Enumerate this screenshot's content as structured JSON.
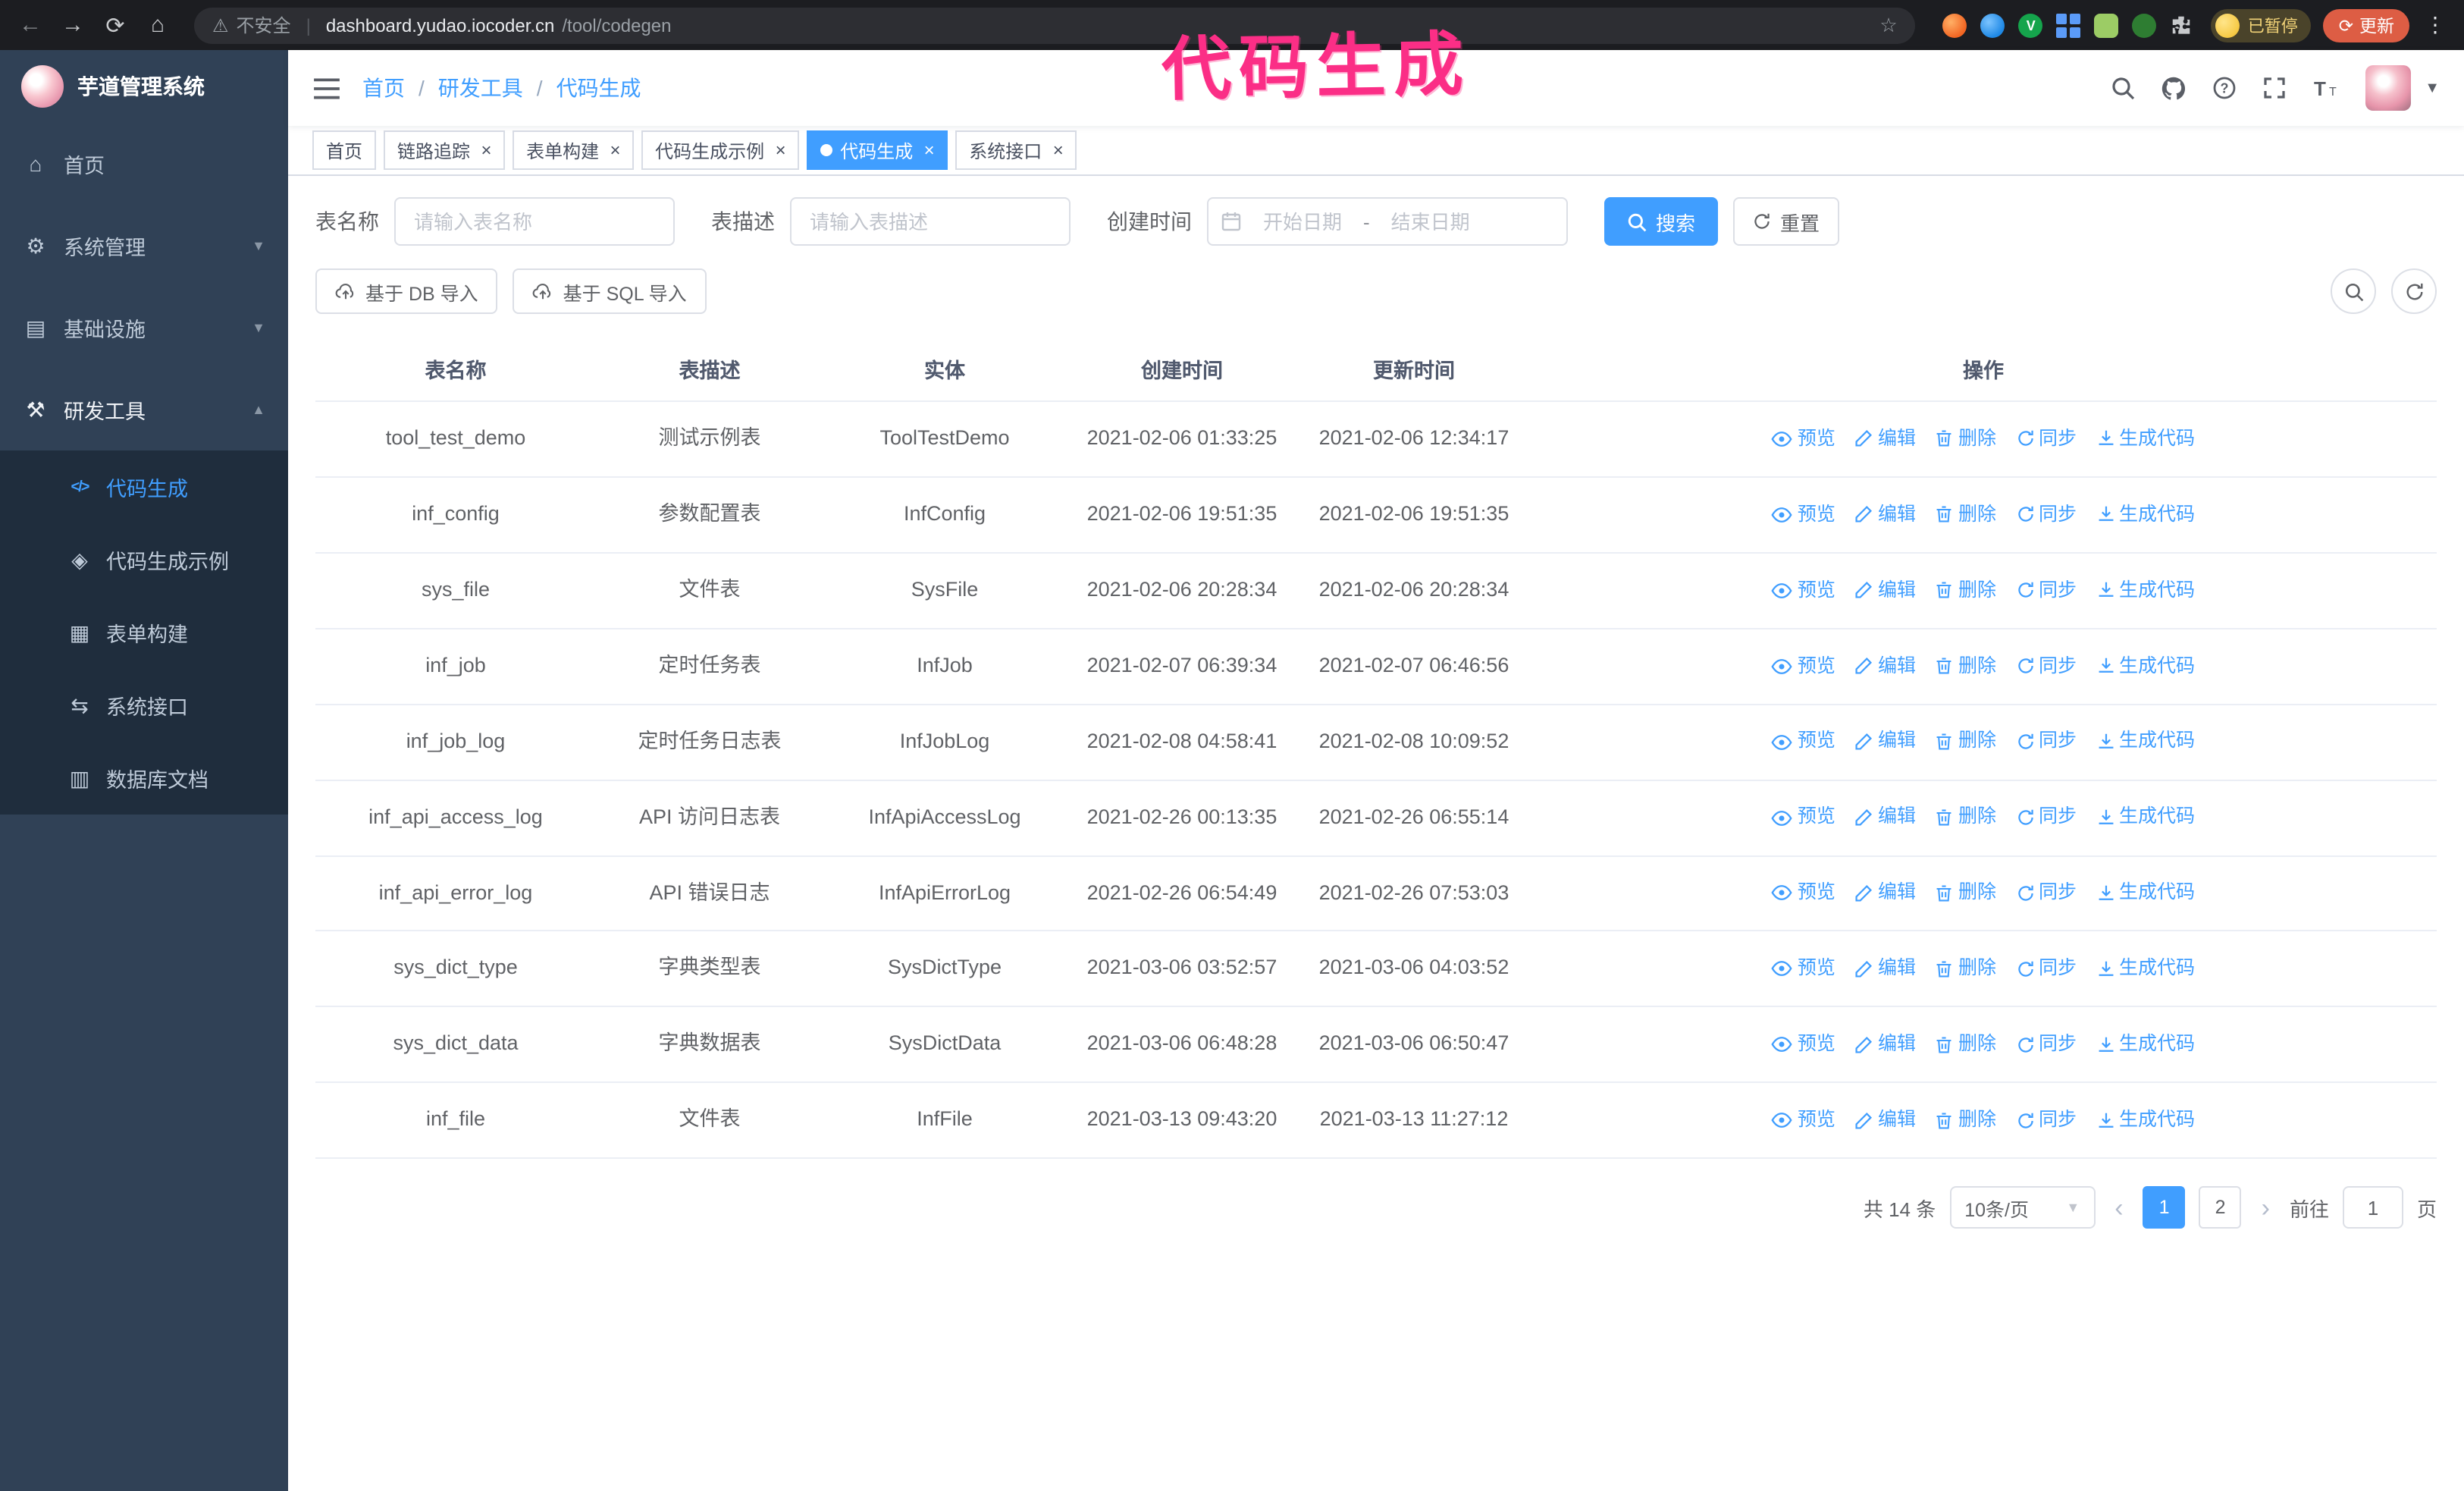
{
  "browser": {
    "security_label": "不安全",
    "url_host": "dashboard.yudao.iocoder.cn",
    "url_path": "/tool/codegen",
    "paused_badge": "已暂停",
    "update_label": "更新"
  },
  "annotation": "代码生成",
  "sidebar": {
    "logo_title": "芋道管理系统",
    "items": [
      {
        "label": "首页"
      },
      {
        "label": "系统管理"
      },
      {
        "label": "基础设施"
      },
      {
        "label": "研发工具"
      }
    ],
    "subitems": [
      {
        "label": "代码生成",
        "active": true
      },
      {
        "label": "代码生成示例"
      },
      {
        "label": "表单构建"
      },
      {
        "label": "系统接口"
      },
      {
        "label": "数据库文档"
      }
    ]
  },
  "header": {
    "breadcrumb": [
      "首页",
      "研发工具",
      "代码生成"
    ],
    "breadcrumb_separator": "/"
  },
  "tabs": [
    {
      "label": "首页",
      "closable": false,
      "active": false
    },
    {
      "label": "链路追踪",
      "closable": true,
      "active": false
    },
    {
      "label": "表单构建",
      "closable": true,
      "active": false
    },
    {
      "label": "代码生成示例",
      "closable": true,
      "active": false
    },
    {
      "label": "代码生成",
      "closable": true,
      "active": true
    },
    {
      "label": "系统接口",
      "closable": true,
      "active": false
    }
  ],
  "filters": {
    "table_name_label": "表名称",
    "table_name_placeholder": "请输入表名称",
    "table_desc_label": "表描述",
    "table_desc_placeholder": "请输入表描述",
    "create_time_label": "创建时间",
    "start_date_placeholder": "开始日期",
    "range_separator": "-",
    "end_date_placeholder": "结束日期",
    "search_button": "搜索",
    "reset_button": "重置"
  },
  "toolbar": {
    "import_db": "基于 DB 导入",
    "import_sql": "基于 SQL 导入"
  },
  "table": {
    "columns": [
      "表名称",
      "表描述",
      "实体",
      "创建时间",
      "更新时间",
      "操作"
    ],
    "actions": [
      "预览",
      "编辑",
      "删除",
      "同步",
      "生成代码"
    ],
    "rows": [
      {
        "name": "tool_test_demo",
        "desc": "测试示例表",
        "entity": "ToolTestDemo",
        "created": "2021-02-06 01:33:25",
        "updated": "2021-02-06 12:34:17"
      },
      {
        "name": "inf_config",
        "desc": "参数配置表",
        "entity": "InfConfig",
        "created": "2021-02-06 19:51:35",
        "updated": "2021-02-06 19:51:35"
      },
      {
        "name": "sys_file",
        "desc": "文件表",
        "entity": "SysFile",
        "created": "2021-02-06 20:28:34",
        "updated": "2021-02-06 20:28:34"
      },
      {
        "name": "inf_job",
        "desc": "定时任务表",
        "entity": "InfJob",
        "created": "2021-02-07 06:39:34",
        "updated": "2021-02-07 06:46:56"
      },
      {
        "name": "inf_job_log",
        "desc": "定时任务日志表",
        "entity": "InfJobLog",
        "created": "2021-02-08 04:58:41",
        "updated": "2021-02-08 10:09:52"
      },
      {
        "name": "inf_api_access_log",
        "desc": "API 访问日志表",
        "entity": "InfApiAccessLog",
        "created": "2021-02-26 00:13:35",
        "updated": "2021-02-26 06:55:14"
      },
      {
        "name": "inf_api_error_log",
        "desc": "API 错误日志",
        "entity": "InfApiErrorLog",
        "created": "2021-02-26 06:54:49",
        "updated": "2021-02-26 07:53:03"
      },
      {
        "name": "sys_dict_type",
        "desc": "字典类型表",
        "entity": "SysDictType",
        "created": "2021-03-06 03:52:57",
        "updated": "2021-03-06 04:03:52"
      },
      {
        "name": "sys_dict_data",
        "desc": "字典数据表",
        "entity": "SysDictData",
        "created": "2021-03-06 06:48:28",
        "updated": "2021-03-06 06:50:47"
      },
      {
        "name": "inf_file",
        "desc": "文件表",
        "entity": "InfFile",
        "created": "2021-03-13 09:43:20",
        "updated": "2021-03-13 11:27:12"
      }
    ]
  },
  "pagination": {
    "total": "共 14 条",
    "page_size": "10条/页",
    "pages": [
      {
        "label": "1",
        "active": true
      },
      {
        "label": "2",
        "active": false
      }
    ],
    "goto_label": "前往",
    "goto_value": "1",
    "page_label": "页"
  }
}
